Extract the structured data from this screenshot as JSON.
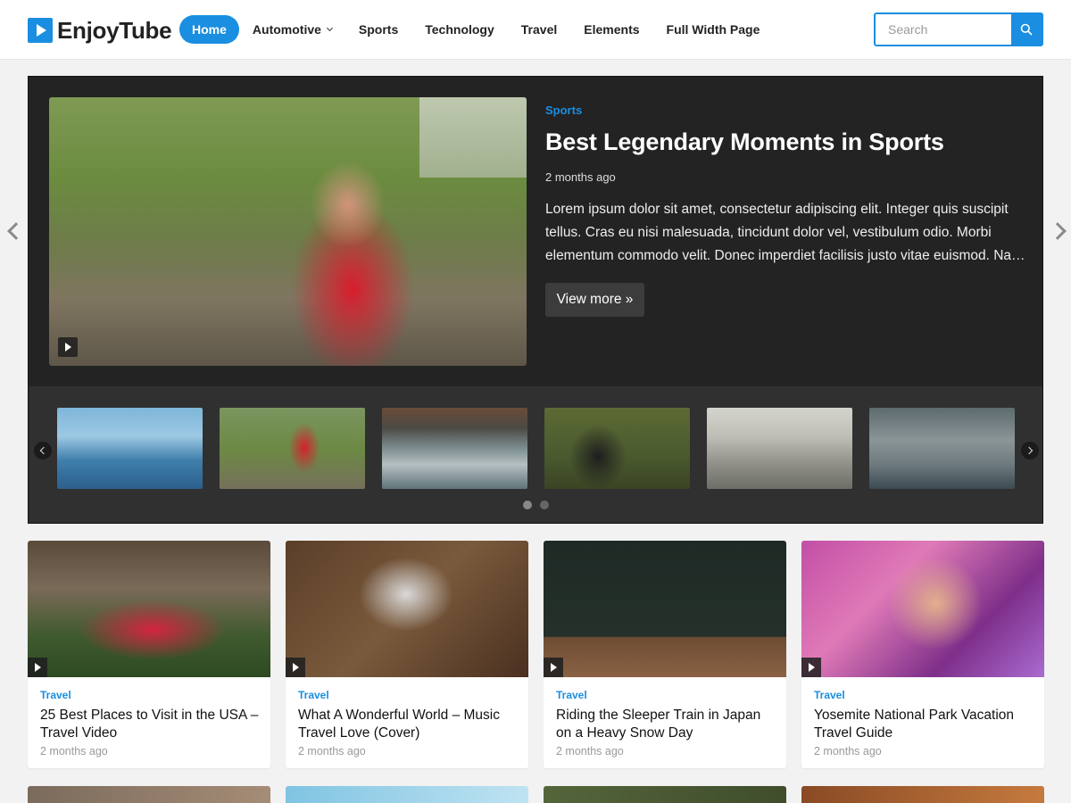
{
  "brand": {
    "name": "EnjoyTube",
    "accent_color": "#1a8ee0"
  },
  "nav": {
    "items": [
      {
        "label": "Home",
        "active": true
      },
      {
        "label": "Automotive",
        "has_dropdown": true
      },
      {
        "label": "Sports"
      },
      {
        "label": "Technology"
      },
      {
        "label": "Travel"
      },
      {
        "label": "Elements"
      },
      {
        "label": "Full Width Page"
      }
    ]
  },
  "search": {
    "placeholder": "Search",
    "icon": "search-icon"
  },
  "hero": {
    "category": "Sports",
    "title": "Best Legendary Moments in Sports",
    "date": "2 months ago",
    "excerpt": "Lorem ipsum dolor sit amet, consectetur adipiscing elit. Integer quis suscipit tellus. Cras eu nisi malesuada, tincidunt dolor vel, vestibulum odio. Morbi elementum commodo velit. Donec imperdiet facilisis justo vitae euismod. Na…",
    "button_label": "View more »"
  },
  "carousel": {
    "thumb_count": 6,
    "page_count": 2,
    "active_page": 1
  },
  "cards": [
    {
      "category": "Travel",
      "title": "25 Best Places to Visit in the USA – Travel Video",
      "date": "2 months ago"
    },
    {
      "category": "Travel",
      "title": "What A Wonderful World – Music Travel Love (Cover)",
      "date": "2 months ago"
    },
    {
      "category": "Travel",
      "title": "Riding the Sleeper Train in Japan on a Heavy Snow Day",
      "date": "2 months ago"
    },
    {
      "category": "Travel",
      "title": "Yosemite National Park Vacation Travel Guide",
      "date": "2 months ago"
    }
  ]
}
